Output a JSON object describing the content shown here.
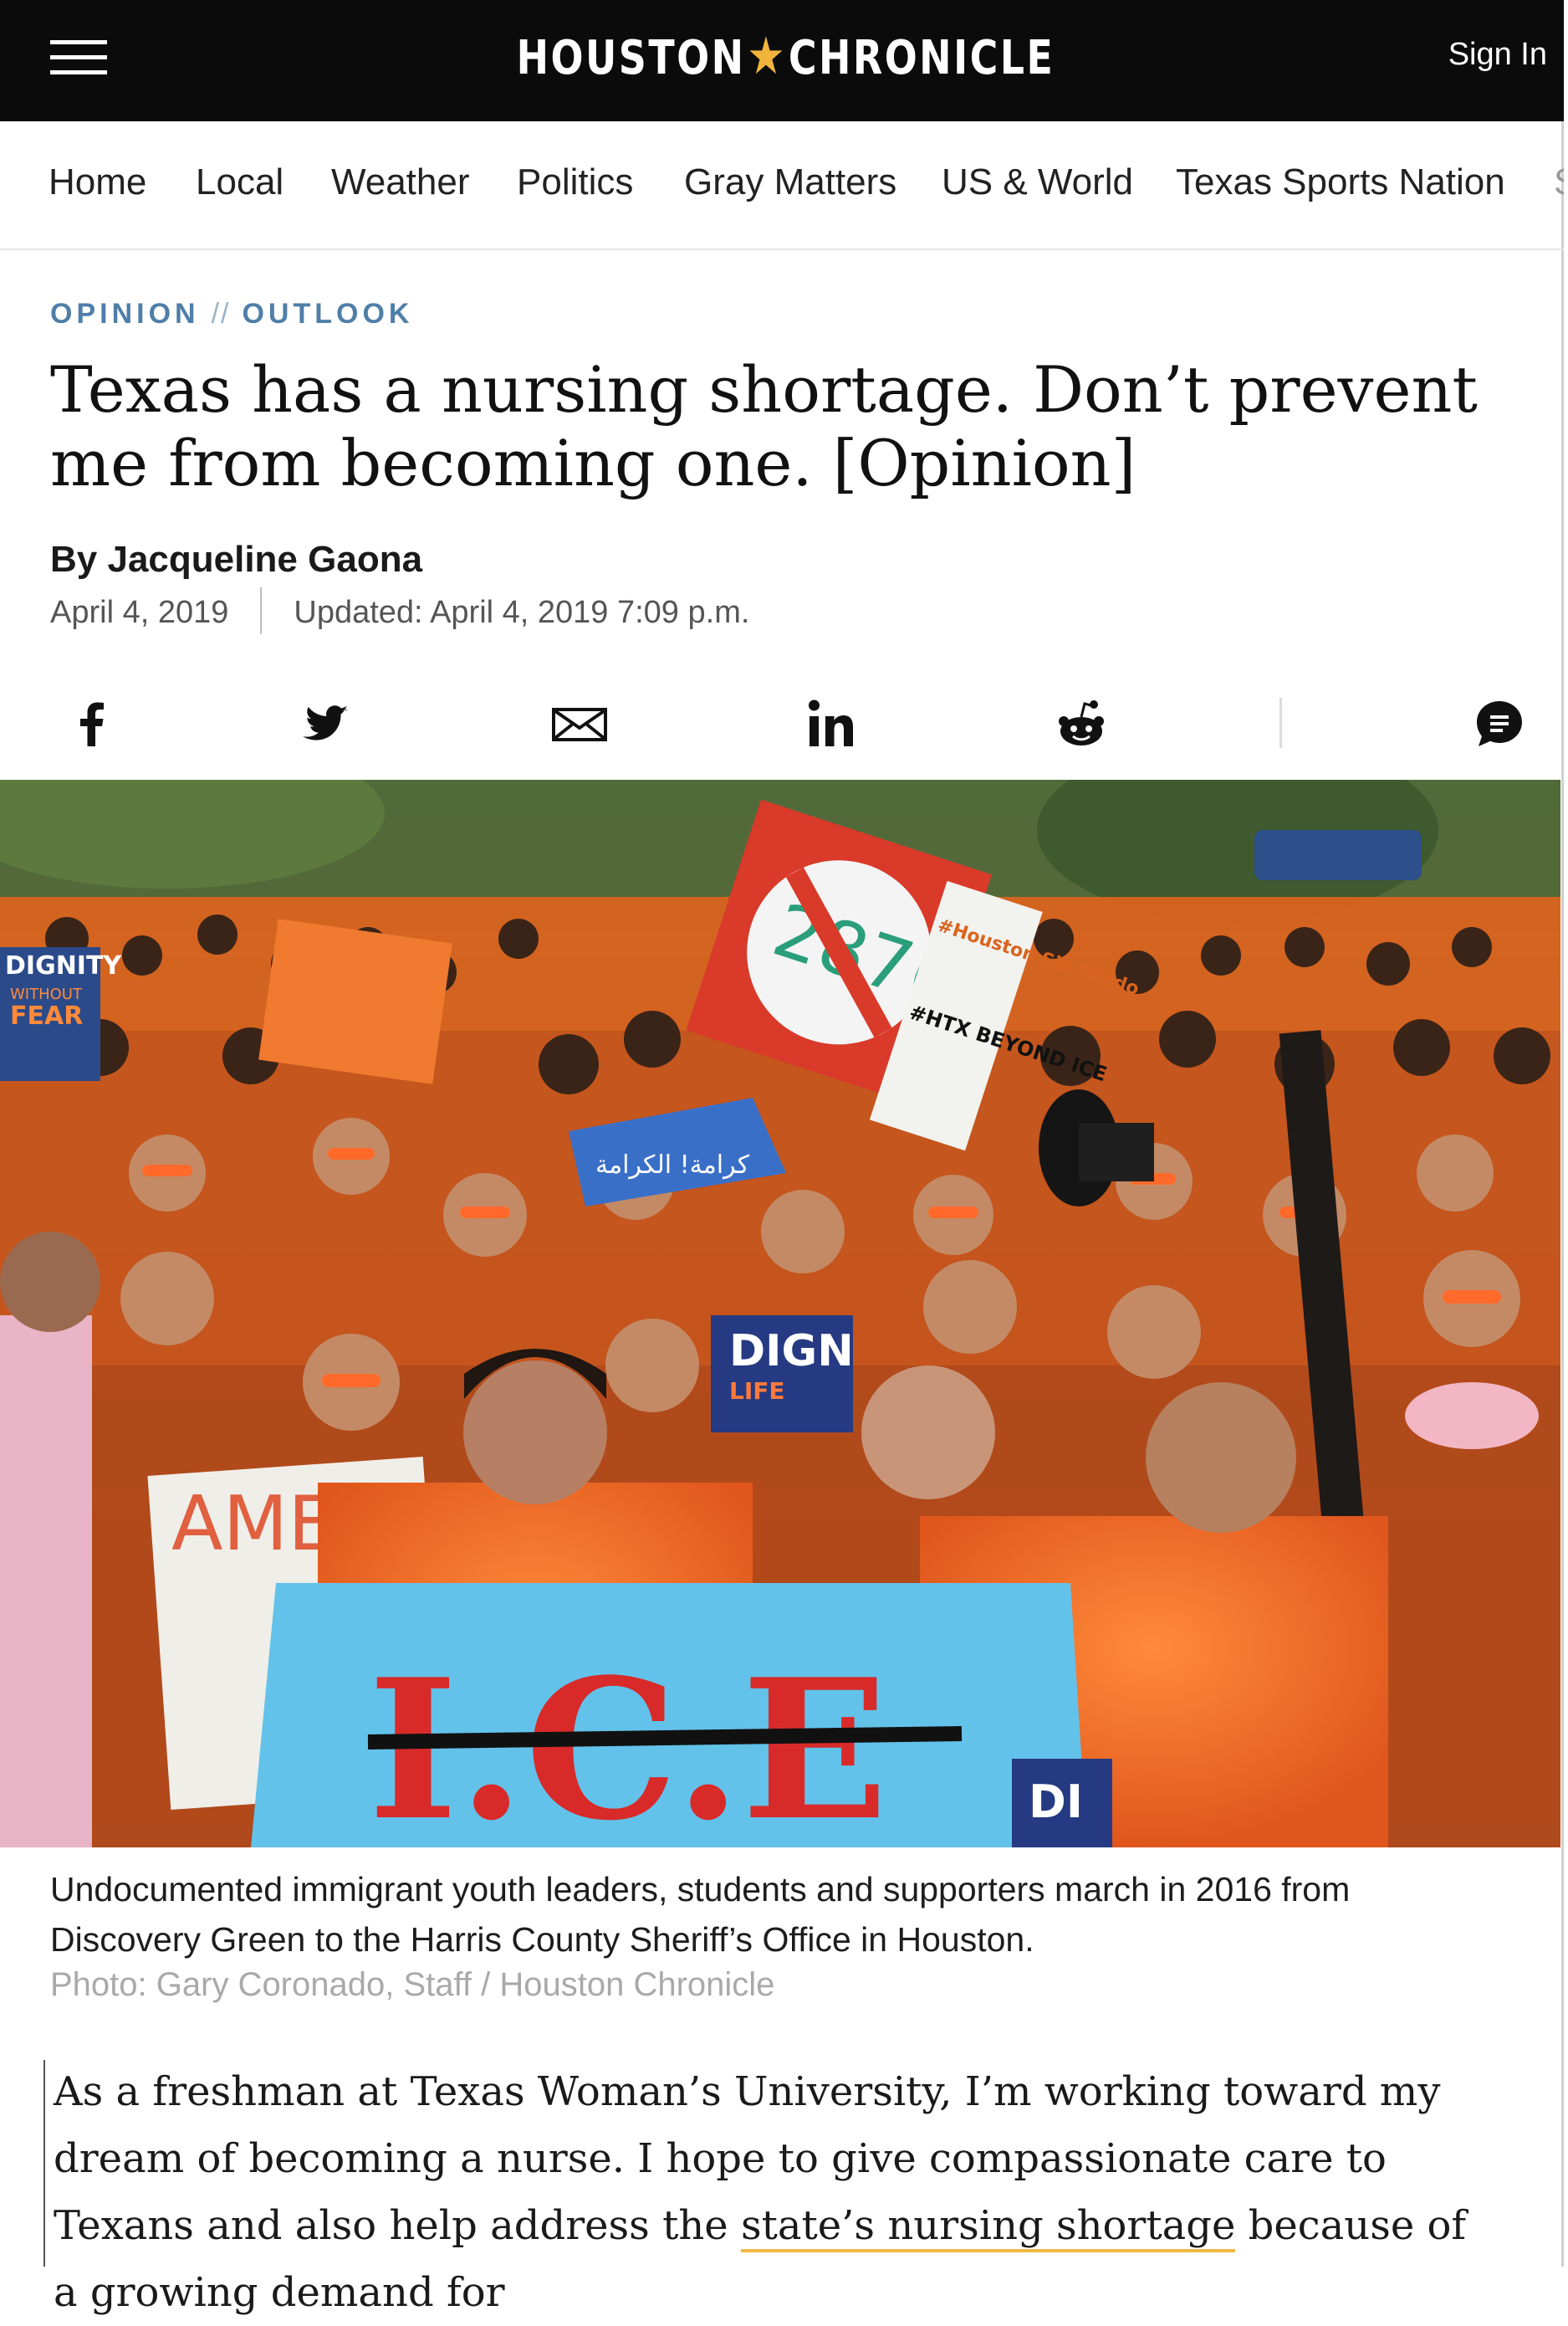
{
  "header": {
    "logo_left": "HOUSTON",
    "logo_star": "★",
    "logo_right": "CHRONICLE",
    "sign_in": "Sign In"
  },
  "nav": {
    "items": [
      "Home",
      "Local",
      "Weather",
      "Politics",
      "Gray Matters",
      "US & World",
      "Texas Sports Nation",
      "S"
    ]
  },
  "article": {
    "section": "OPINION",
    "separator": "//",
    "subsection": "OUTLOOK",
    "headline": "Texas has a nursing shortage. Don’t prevent me from becoming one. [Opinion]",
    "byline": "By Jacqueline Gaona",
    "date": "April 4, 2019",
    "updated": "Updated: April 4, 2019 7:09 p.m."
  },
  "share": {
    "icons": [
      "facebook-icon",
      "twitter-icon",
      "email-icon",
      "linkedin-icon",
      "reddit-icon",
      "comments-icon"
    ]
  },
  "photo": {
    "sign_287": "287(g)",
    "sign_htx": "#HTX BEYOND ICE",
    "sign_sin_miedo": "#Houston Sin Miedo",
    "sign_ice": "I.C.E",
    "sign_dign": "DIGN",
    "sign_life": "LIFE",
    "sign_amer": "AMER",
    "sign_dignity": "DIGNITY",
    "sign_without": "WITHOUT",
    "sign_fear": "FEAR",
    "sign_di": "DI",
    "sign_arabic": "كرامة! الكرامة",
    "caption": "Undocumented immigrant youth leaders, students and supporters march in 2016 from Discovery Green to the Harris County Sheriff’s Office in Houston.",
    "credit": "Photo: Gary Coronado, Staff / Houston Chronicle"
  },
  "body": {
    "p1_before": "As a freshman at Texas Woman’s University, I’m working toward my dream of becoming a nurse. I hope to give compassionate care to Texans and also help address the ",
    "p1_link": "state’s nursing shortage",
    "p1_after": " because of a growing demand for"
  }
}
